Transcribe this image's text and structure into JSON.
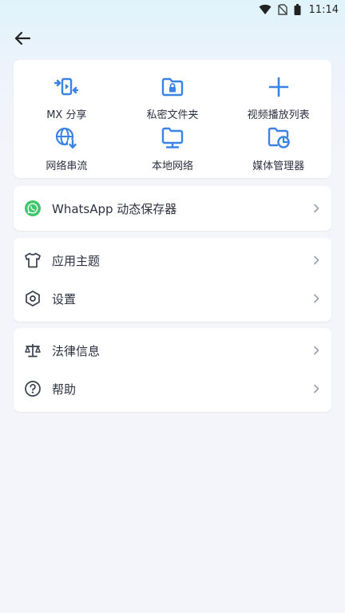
{
  "status_bar": {
    "time": "11:14",
    "icons": [
      "wifi-icon",
      "no-sim-icon",
      "battery-icon"
    ]
  },
  "toolbar": {
    "back_icon": "arrow-left-icon"
  },
  "quick_actions": [
    {
      "label": "MX 分享",
      "icon": "mx-share-icon"
    },
    {
      "label": "私密文件夹",
      "icon": "private-folder-icon"
    },
    {
      "label": "视频播放列表",
      "icon": "plus-icon"
    },
    {
      "label": "网络串流",
      "icon": "network-stream-icon"
    },
    {
      "label": "本地网络",
      "icon": "local-network-icon"
    },
    {
      "label": "媒体管理器",
      "icon": "media-manager-icon"
    }
  ],
  "whatsapp": {
    "label": "WhatsApp 动态保存器",
    "icon": "whatsapp-icon"
  },
  "settings_group": [
    {
      "label": "应用主题",
      "icon": "tshirt-icon"
    },
    {
      "label": "设置",
      "icon": "hexagon-settings-icon"
    }
  ],
  "legal_group": [
    {
      "label": "法律信息",
      "icon": "scale-icon"
    },
    {
      "label": "帮助",
      "icon": "help-icon"
    }
  ],
  "colors": {
    "accent": "#3b82e6",
    "whatsapp_green": "#3ec86b",
    "text": "#2d3142",
    "chevron": "#9aa0ab"
  }
}
